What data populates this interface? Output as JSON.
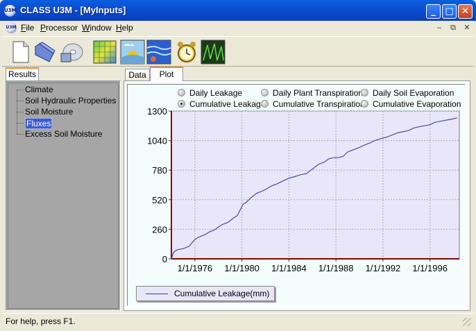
{
  "window": {
    "logo_text": "U3M",
    "title": "CLASS U3M - [MyInputs]",
    "minimize": "_",
    "maximize": "□",
    "close": "✕"
  },
  "menu": {
    "items": [
      "File",
      "Processor",
      "Window",
      "Help"
    ],
    "mdi_min": "–",
    "mdi_restore": "⧉",
    "mdi_close": "✕"
  },
  "toolbar": {
    "icons": [
      "new-file-icon",
      "open-folder-icon",
      "save-disk-icon",
      "grid-map-icon",
      "weather-icon",
      "water-icon",
      "alarm-clock-icon",
      "vegetation-chart-icon"
    ]
  },
  "left_panel": {
    "tab": "Results",
    "tree": [
      "Climate",
      "Soil Hydraulic Properties",
      "Soil Moisture",
      "Fluxes",
      "Excess Soil Moisture"
    ],
    "selected": "Fluxes"
  },
  "right_panel": {
    "tabs": [
      "Data",
      "Plot"
    ],
    "active_tab": "Plot",
    "options": [
      {
        "label": "Daily Leakage",
        "checked": false
      },
      {
        "label": "Daily Plant Transpiration",
        "checked": false
      },
      {
        "label": "Daily Soil Evaporation",
        "checked": false
      },
      {
        "label": "Cumulative Leakage",
        "checked": true
      },
      {
        "label": "Cumulative Transpiration",
        "checked": false
      },
      {
        "label": "Cumulative Evaporation",
        "checked": false
      }
    ]
  },
  "chart_data": {
    "type": "line",
    "title": "",
    "xlabel": "",
    "ylabel": "",
    "ylim": [
      0,
      1300
    ],
    "yticks": [
      0,
      260,
      520,
      780,
      1040,
      1300
    ],
    "xlim": [
      1974.0,
      1998.5
    ],
    "xtick_labels": [
      "1/1/1976",
      "1/1/1980",
      "1/1/1984",
      "1/1/1988",
      "1/1/1992",
      "1/1/1996"
    ],
    "xticks": [
      1976,
      1980,
      1984,
      1988,
      1992,
      1996
    ],
    "grid": true,
    "legend": "bottom-left",
    "colors": {
      "series": "#4a4aa5",
      "plot_bg": "#e8e6f8",
      "axis": "#8b0000"
    },
    "series": [
      {
        "name": "Cumulative Leakage(mm)",
        "x": [
          1974.0,
          1974.2,
          1974.5,
          1975.0,
          1975.5,
          1976.0,
          1976.3,
          1976.8,
          1977.3,
          1977.6,
          1978.0,
          1978.3,
          1978.8,
          1979.3,
          1979.6,
          1980.1,
          1980.4,
          1980.8,
          1981.3,
          1981.6,
          1982.0,
          1982.5,
          1983.0,
          1983.6,
          1984.0,
          1984.4,
          1985.0,
          1985.5,
          1986.0,
          1986.5,
          1987.0,
          1987.4,
          1987.8,
          1988.2,
          1988.6,
          1989.0,
          1989.5,
          1990.0,
          1990.4,
          1990.9,
          1991.3,
          1991.9,
          1992.3,
          1992.8,
          1993.3,
          1993.8,
          1994.2,
          1994.6,
          1995.0,
          1995.5,
          1996.0,
          1996.4,
          1996.9,
          1997.4,
          1997.9,
          1998.3
        ],
        "values": [
          0,
          60,
          80,
          90,
          110,
          170,
          190,
          210,
          240,
          250,
          280,
          300,
          320,
          360,
          380,
          480,
          500,
          540,
          580,
          590,
          610,
          640,
          660,
          690,
          710,
          720,
          740,
          750,
          790,
          830,
          850,
          880,
          890,
          890,
          900,
          940,
          960,
          980,
          1000,
          1020,
          1040,
          1060,
          1070,
          1090,
          1110,
          1120,
          1130,
          1150,
          1160,
          1170,
          1180,
          1200,
          1210,
          1220,
          1230,
          1240
        ]
      }
    ]
  },
  "status": {
    "text": "For help, press F1."
  }
}
